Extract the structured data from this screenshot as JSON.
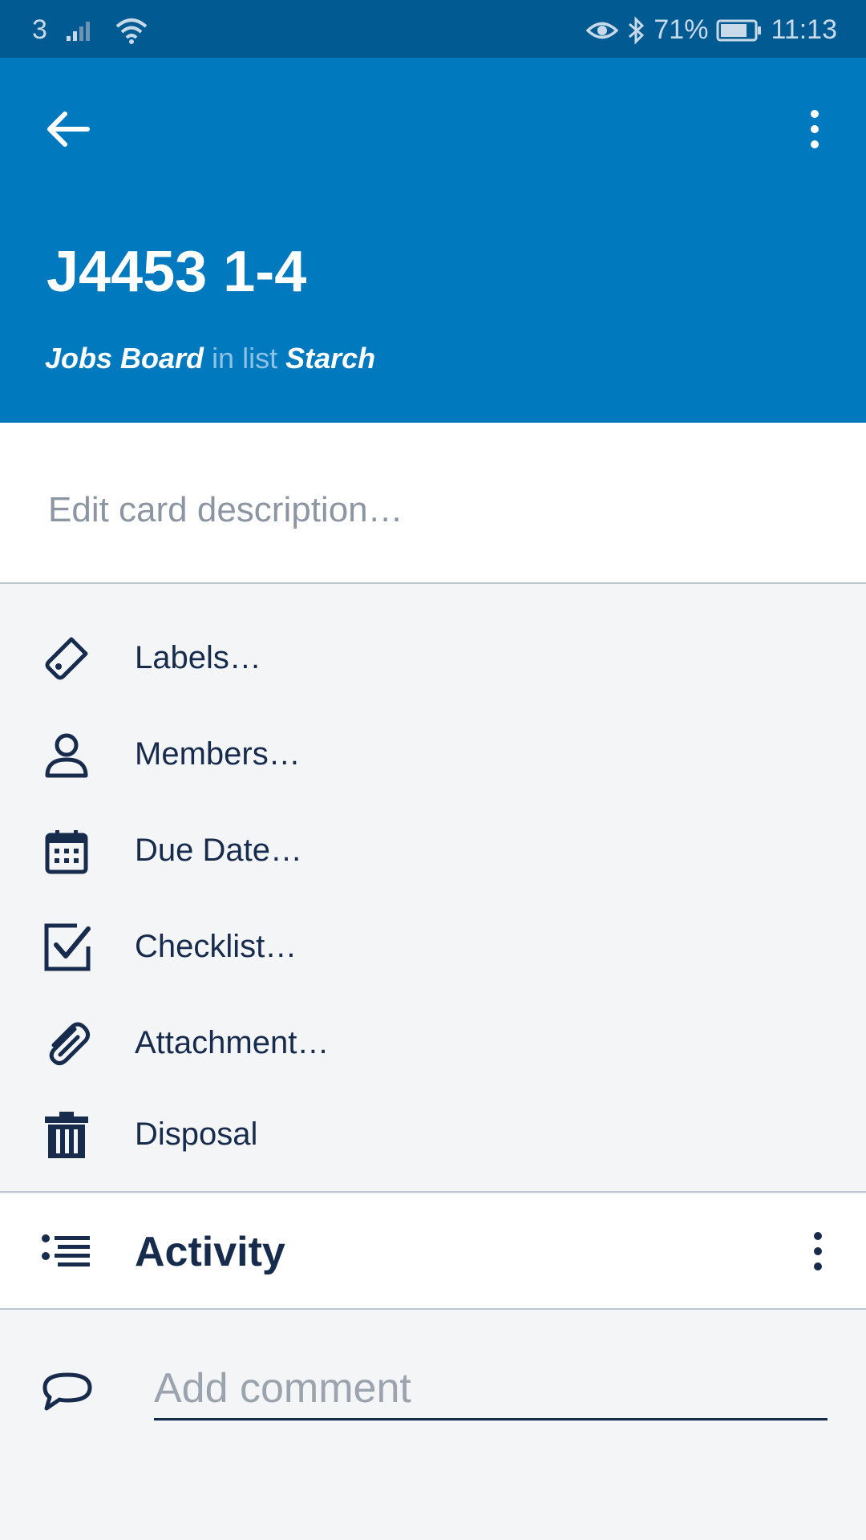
{
  "status": {
    "carrier": "3",
    "battery": "71%",
    "time": "11:13"
  },
  "header": {
    "title": "J4453 1-4",
    "board": "Jobs Board",
    "in_list": "in list",
    "list": "Starch"
  },
  "description": {
    "placeholder": "Edit card description…"
  },
  "actions": [
    {
      "label": "Labels…",
      "icon": "tag-icon"
    },
    {
      "label": "Members…",
      "icon": "person-icon"
    },
    {
      "label": "Due Date…",
      "icon": "calendar-icon"
    },
    {
      "label": "Checklist…",
      "icon": "checkbox-icon"
    },
    {
      "label": "Attachment…",
      "icon": "paperclip-icon"
    },
    {
      "label": "Disposal",
      "icon": "trash-icon"
    }
  ],
  "activity": {
    "title": "Activity"
  },
  "comment": {
    "placeholder": "Add comment"
  },
  "colors": {
    "header": "#0079bf",
    "statusbar": "#025a92",
    "text": "#172b4d",
    "background": "#f4f5f7"
  }
}
